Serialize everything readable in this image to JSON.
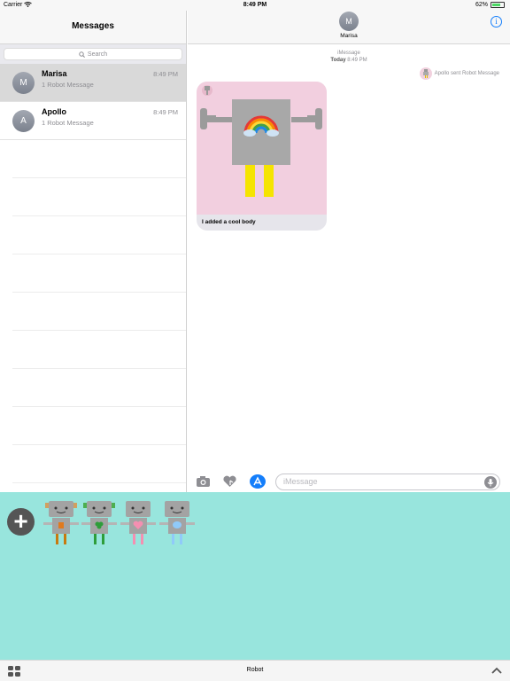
{
  "status_bar": {
    "carrier": "Carrier",
    "time": "8:49 PM",
    "battery": "62%",
    "battery_level": 0.62
  },
  "sidebar": {
    "title": "Messages",
    "search_placeholder": "Search",
    "conversations": [
      {
        "initial": "M",
        "name": "Marisa",
        "preview": "1 Robot Message",
        "time": "8:49 PM",
        "selected": true
      },
      {
        "initial": "A",
        "name": "Apollo",
        "preview": "1 Robot Message",
        "time": "8:49 PM",
        "selected": false
      }
    ]
  },
  "conversation": {
    "contact_initial": "M",
    "contact_name": "Marisa",
    "service": "iMessage",
    "day_label": "Today",
    "time": "8:49 PM",
    "sent_note": "Apollo sent Robot Message",
    "bubble_caption": "I added a cool body",
    "input_placeholder": "iMessage"
  },
  "drawer": {
    "app_name": "Robot",
    "plus_label": "+"
  },
  "colors": {
    "accent": "#147efb",
    "drawer": "#98e5dd",
    "bubble_bg": "#f2cfdf"
  },
  "icons": [
    "wifi-icon",
    "battery-icon",
    "info-icon",
    "camera-icon",
    "digital-touch-icon",
    "app-store-icon",
    "microphone-icon",
    "app-grid-icon",
    "chevron-up-icon",
    "search-icon"
  ]
}
